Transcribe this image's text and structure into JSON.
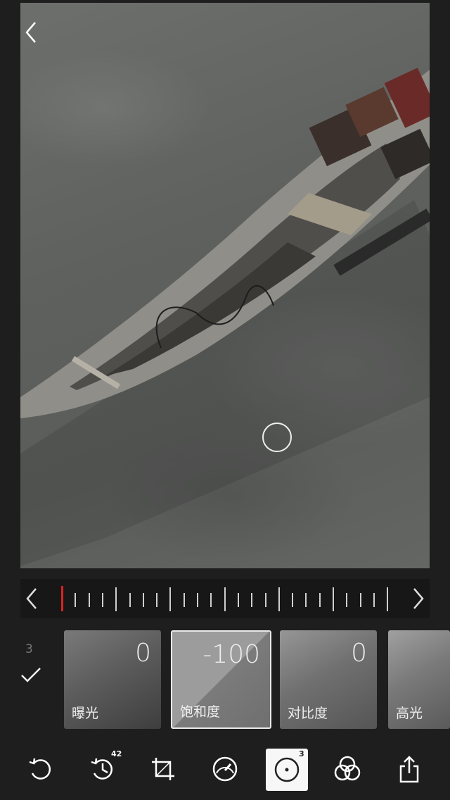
{
  "tools": [
    {
      "label": "曝光",
      "value": "0"
    },
    {
      "label": "饱和度",
      "value": "-100"
    },
    {
      "label": "对比度",
      "value": "0"
    },
    {
      "label": "高光",
      "value": ""
    }
  ],
  "left_panel": {
    "count": "3"
  },
  "bottom_bar": {
    "history_badge": "42",
    "selective_badge": "3",
    "icons": [
      "undo-icon",
      "history-icon",
      "crop-icon",
      "tune-dial-icon",
      "selective-adjust-icon",
      "filters-icon",
      "share-icon"
    ]
  },
  "slider": {
    "value_fraction": 0.0
  },
  "colors": {
    "background": "#1e1e1e",
    "marker": "#dd2222",
    "active_border": "#e9e9e9"
  }
}
